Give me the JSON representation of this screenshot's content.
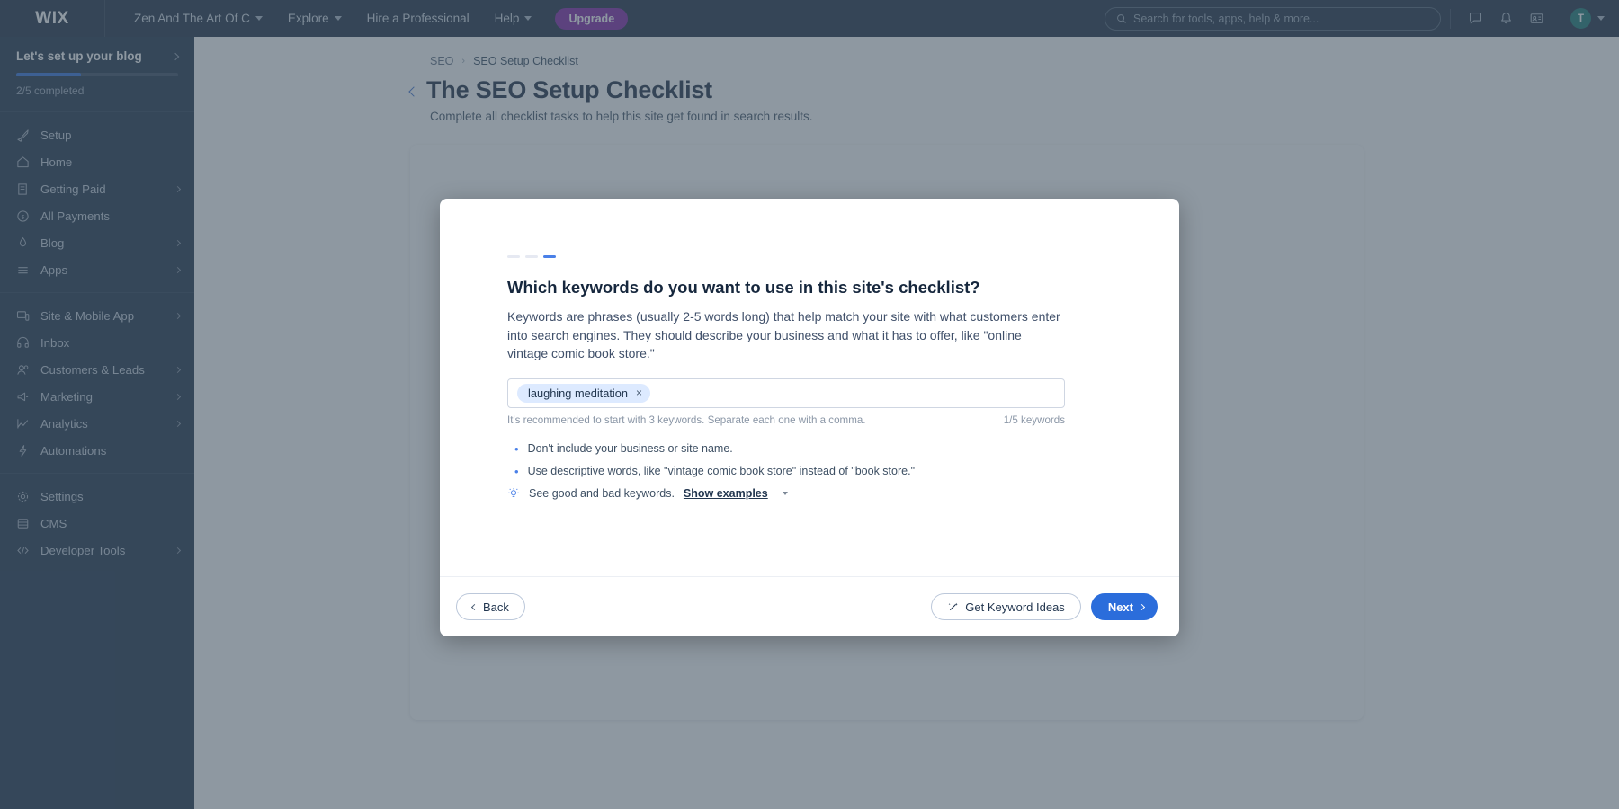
{
  "topbar": {
    "logo": "WIX",
    "nav": [
      {
        "label": "Zen And The Art Of C",
        "has_caret": true
      },
      {
        "label": "Explore",
        "has_caret": true
      },
      {
        "label": "Hire a Professional",
        "has_caret": false
      },
      {
        "label": "Help",
        "has_caret": true
      }
    ],
    "upgrade_label": "Upgrade",
    "search_placeholder": "Search for tools, apps, help & more...",
    "icons": [
      "chat-bubble-icon",
      "bell-icon",
      "contacts-card-icon"
    ],
    "avatar_initial": "T"
  },
  "sidebar": {
    "setup": {
      "title": "Let's set up your blog",
      "progress_percent": 40,
      "progress_label": "2/5 completed"
    },
    "groups": [
      {
        "items": [
          {
            "label": "Setup",
            "icon": "rocket-icon",
            "expandable": false
          },
          {
            "label": "Home",
            "icon": "home-icon",
            "expandable": false
          },
          {
            "label": "Getting Paid",
            "icon": "invoice-icon",
            "expandable": true
          },
          {
            "label": "All Payments",
            "icon": "coin-icon",
            "expandable": false
          },
          {
            "label": "Blog",
            "icon": "pen-icon",
            "expandable": true
          },
          {
            "label": "Apps",
            "icon": "apps-icon",
            "expandable": true
          }
        ]
      },
      {
        "items": [
          {
            "label": "Site & Mobile App",
            "icon": "monitor-icon",
            "expandable": true
          },
          {
            "label": "Inbox",
            "icon": "inbox-icon",
            "expandable": false
          },
          {
            "label": "Customers & Leads",
            "icon": "people-icon",
            "expandable": true
          },
          {
            "label": "Marketing",
            "icon": "megaphone-icon",
            "expandable": true
          },
          {
            "label": "Analytics",
            "icon": "chart-icon",
            "expandable": true
          },
          {
            "label": "Automations",
            "icon": "bolt-icon",
            "expandable": false
          }
        ]
      },
      {
        "items": [
          {
            "label": "Settings",
            "icon": "gear-icon",
            "expandable": false
          },
          {
            "label": "CMS",
            "icon": "database-icon",
            "expandable": false
          },
          {
            "label": "Developer Tools",
            "icon": "code-icon",
            "expandable": true
          }
        ]
      }
    ]
  },
  "page": {
    "breadcrumb_root": "SEO",
    "breadcrumb_sep": "›",
    "breadcrumb_current": "SEO Setup Checklist",
    "title": "The SEO Setup Checklist",
    "subtitle": "Complete all checklist tasks to help this site get found in search results."
  },
  "modal": {
    "steps": {
      "total": 3,
      "active_index": 2
    },
    "title": "Which keywords do you want to use in this site's checklist?",
    "description": "Keywords are phrases (usually 2-5 words long) that help match your site with what customers enter into search engines. They should describe your business and what it has to offer, like \"online vintage comic book store.\"",
    "keywords": [
      {
        "label": "laughing meditation",
        "remove_symbol": "×"
      }
    ],
    "input_placeholder": "",
    "hint": "It's recommended to start with 3 keywords. Separate each one with a comma.",
    "counter": "1/5 keywords",
    "tips": [
      "Don't include your business or site name.",
      "Use descriptive words, like \"vintage comic book store\" instead of \"book store.\""
    ],
    "examples_prompt": "See good and bad keywords.",
    "examples_link": "Show examples",
    "footer": {
      "back_label": "Back",
      "keyword_ideas_label": "Get Keyword Ideas",
      "next_label": "Next"
    }
  },
  "colors": {
    "brand_blue": "#2b6ddb",
    "sidebar_bg": "#172b42",
    "topbar_bg": "#16273d",
    "upgrade_purple": "#7b1fa2",
    "avatar_teal": "#12756e",
    "tag_blue": "#ddeaff"
  }
}
